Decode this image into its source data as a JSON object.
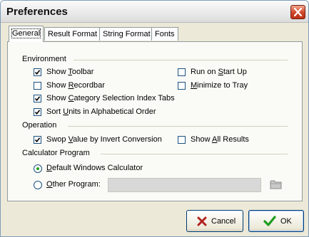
{
  "window": {
    "title": "Preferences"
  },
  "tabs": [
    {
      "label": "General",
      "active": true
    },
    {
      "label": "Result Format",
      "active": false
    },
    {
      "label": "String Format",
      "active": false
    },
    {
      "label": "Fonts",
      "active": false
    }
  ],
  "environment": {
    "heading": "Environment",
    "options": [
      {
        "pre": "Show ",
        "key": "T",
        "post": "oolbar",
        "checked": true
      },
      {
        "pre": "Show ",
        "key": "R",
        "post": "ecordbar",
        "checked": false
      },
      {
        "pre": "Show ",
        "key": "C",
        "post": "ategory Selection Index Tabs",
        "checked": true
      },
      {
        "pre": "Sort ",
        "key": "U",
        "post": "nits in Alphabetical Order",
        "checked": true
      },
      {
        "pre": "Run on ",
        "key": "S",
        "post": "tart Up",
        "checked": false
      },
      {
        "pre": "",
        "key": "M",
        "post": "inimize to Tray",
        "checked": false
      }
    ]
  },
  "operation": {
    "heading": "Operation",
    "options": [
      {
        "pre": "Swop ",
        "key": "V",
        "post": "alue by Invert Conversion",
        "checked": true
      },
      {
        "pre": "Show ",
        "key": "A",
        "post": "ll Results",
        "checked": false
      }
    ]
  },
  "calculator": {
    "heading": "Calculator Program",
    "options": [
      {
        "pre": "",
        "key": "D",
        "post": "efault Windows Calculator",
        "selected": true
      },
      {
        "pre": "",
        "key": "O",
        "post": "ther Program:",
        "selected": false
      }
    ],
    "path_value": ""
  },
  "buttons": {
    "cancel": "Cancel",
    "ok": "OK"
  },
  "icons": {
    "close": "close-icon",
    "folder": "folder-icon",
    "cancel": "red-x-icon",
    "ok": "green-check-icon"
  },
  "colors": {
    "close_button": "#d1452a",
    "cancel_x": "#b22222",
    "ok_check": "#1f9e1f",
    "radio_dot": "#21a121",
    "dialog_bg": "#ece9d8"
  }
}
